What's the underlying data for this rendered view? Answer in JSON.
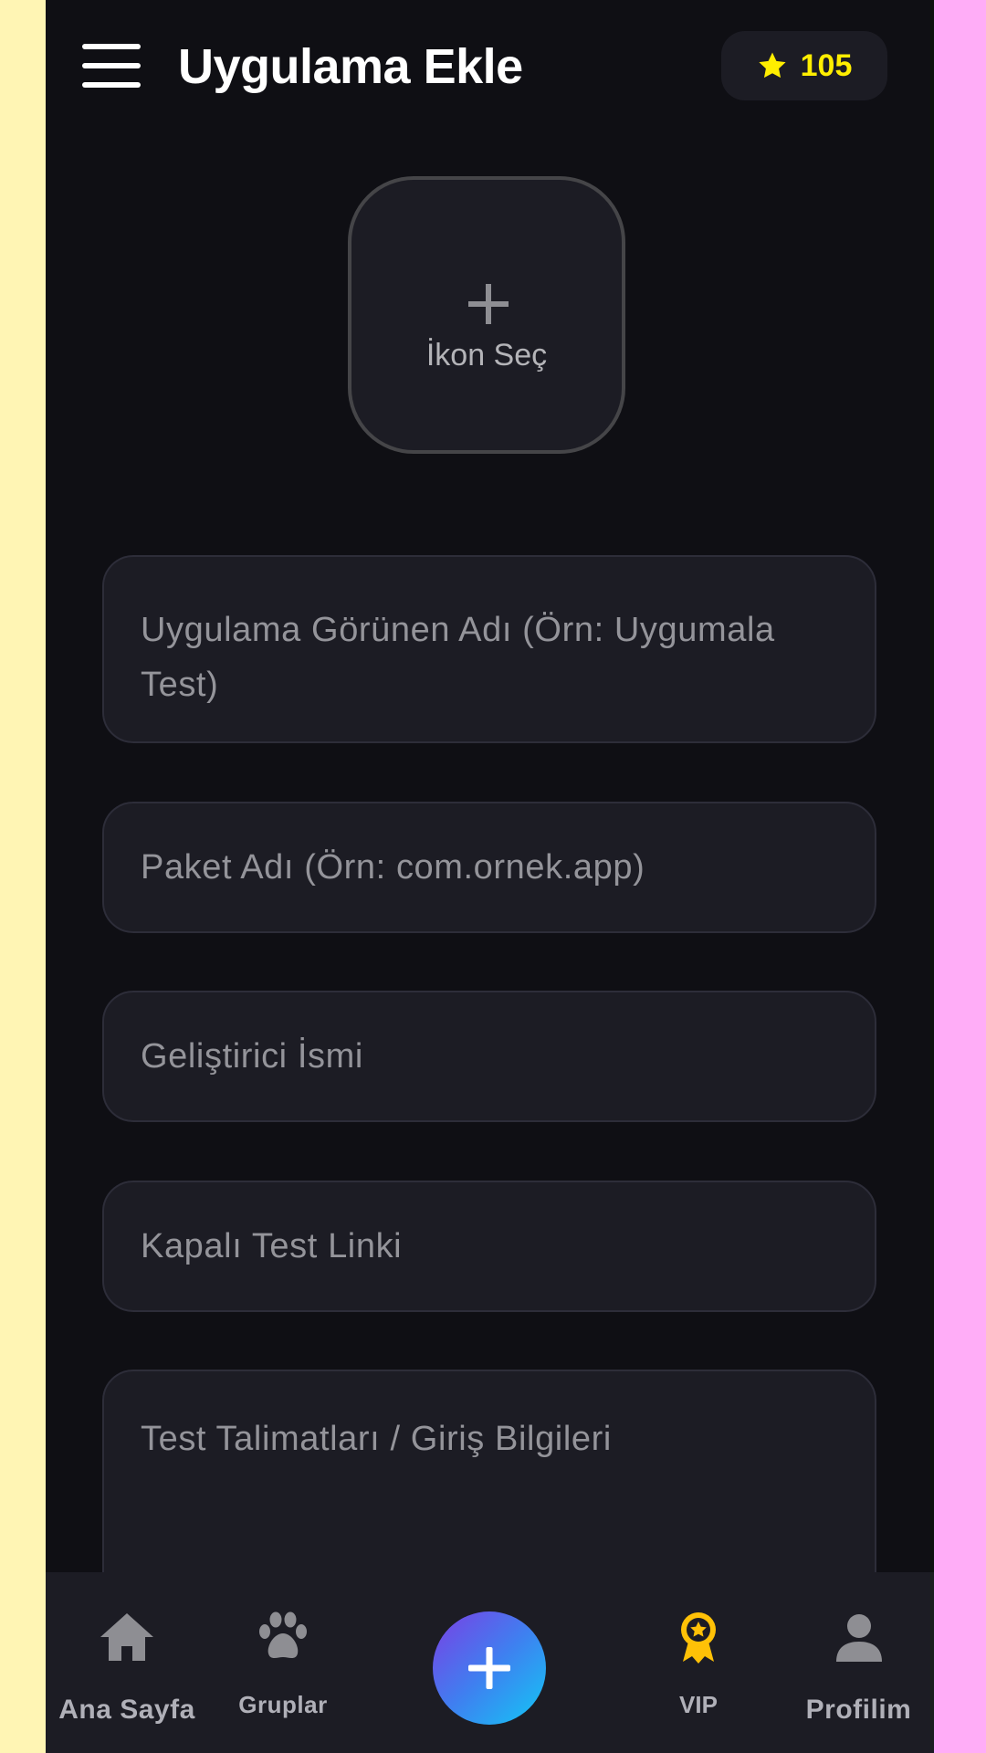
{
  "header": {
    "title": "Uygulama Ekle",
    "points": "105",
    "menu_icon": "hamburger-menu-icon",
    "points_icon": "star-icon"
  },
  "icon_picker": {
    "label": "İkon Seç",
    "icon": "plus-icon"
  },
  "form": {
    "app_name_placeholder": "Uygulama Görünen Adı (Örn: Uygumala Test)",
    "package_placeholder": "Paket Adı (Örn: com.ornek.app)",
    "developer_placeholder": "Geliştirici İsmi",
    "closed_test_link_placeholder": "Kapalı Test Linki",
    "instructions_placeholder": "Test Talimatları / Giriş Bilgileri"
  },
  "bottom_nav": {
    "home": {
      "label": "Ana Sayfa",
      "icon": "home-icon"
    },
    "groups": {
      "label": "Gruplar",
      "icon": "paw-icon"
    },
    "add": {
      "icon": "plus-icon"
    },
    "vip": {
      "label": "VIP",
      "icon": "award-badge-icon"
    },
    "profile": {
      "label": "Profilim",
      "icon": "person-icon"
    }
  },
  "colors": {
    "background": "#0f0f14",
    "surface": "#1c1c24",
    "accent_yellow": "#ffee00",
    "vip_gold": "#ffc107",
    "add_gradient_start": "#7b3fe4",
    "add_gradient_end": "#12c8f5",
    "left_edge": "#fff5b4",
    "right_edge": "#ffadf7"
  }
}
